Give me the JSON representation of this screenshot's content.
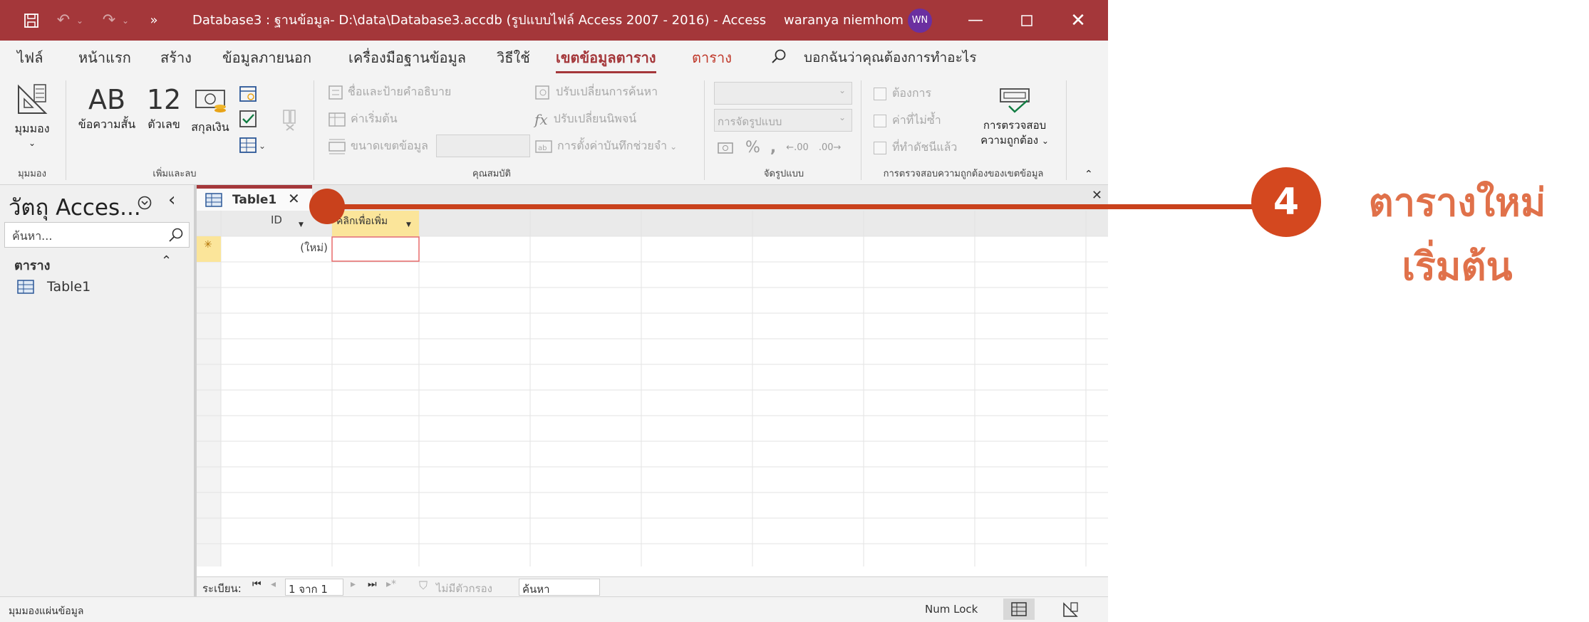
{
  "titlebar": {
    "title": "Database3 : ฐานข้อมูล- D:\\data\\Database3.accdb (รูปแบบไฟล์ Access 2007 - 2016)  -  Access",
    "user": "waranya niemhom",
    "user_initials": "WN",
    "accent": "#a4373a"
  },
  "tabs": [
    {
      "label": "ไฟล์"
    },
    {
      "label": "หน้าแรก"
    },
    {
      "label": "สร้าง"
    },
    {
      "label": "ข้อมูลภายนอก"
    },
    {
      "label": "เครื่องมือฐานข้อมูล"
    },
    {
      "label": "วิธีใช้"
    },
    {
      "label": "เขตข้อมูลตาราง"
    },
    {
      "label": "ตาราง"
    }
  ],
  "tell_me": "บอกฉันว่าคุณต้องการทำอะไร",
  "ribbon": {
    "views": {
      "label": "มุมมอง",
      "group": "มุมมอง"
    },
    "add_delete": {
      "group": "เพิ่มและลบ",
      "short_text_glyph": "AB",
      "short_text": "ข้อความสั้น",
      "number_glyph": "12",
      "number": "ตัวเลข",
      "currency": "สกุลเงิน"
    },
    "properties": {
      "group": "คุณสมบัติ",
      "name_caption": "ชื่อและป้ายคำอธิบาย",
      "default_value": "ค่าเริ่มต้น",
      "field_size": "ขนาดเขตข้อมูล",
      "modify_lookups": "ปรับเปลี่ยนการค้นหา",
      "modify_expression": "ปรับเปลี่ยนนิพจน์",
      "memo_settings": "การตั้งค่าบันทึกช่วยจำ"
    },
    "formatting": {
      "group": "จัดรูปแบบ",
      "format": "การจัดรูปแบบ"
    },
    "validation": {
      "group": "การตรวจสอบความถูกต้องของเขตข้อมูล",
      "required": "ต้องการ",
      "unique": "ค่าที่ไม่ซ้ำ",
      "indexed": "ที่ทำดัชนีแล้ว",
      "validation_line1": "การตรวจสอบ",
      "validation_line2": "ความถูกต้อง"
    }
  },
  "nav": {
    "title": "วัตถุ Acces...",
    "search_placeholder": "ค้นหา...",
    "section": "ตาราง",
    "items": [
      {
        "label": "Table1"
      }
    ]
  },
  "document": {
    "tab_label": "Table1",
    "columns": [
      {
        "label": "ID"
      },
      {
        "label": "คลิกเพื่อเพิ่ม"
      }
    ],
    "new_row_marker": "(ใหม่)",
    "new_row_selector": "✳"
  },
  "record_nav": {
    "label": "ระเบียน:",
    "position": "1 จาก 1",
    "filter": "ไม่มีตัวกรอง",
    "search": "ค้นหา"
  },
  "statusbar": {
    "view": "มุมมองแผ่นข้อมูล",
    "num_lock": "Num Lock"
  },
  "callout": {
    "number": "4",
    "line1": "ตารางใหม่",
    "line2": "เริ่มต้น",
    "color": "#c9411c"
  }
}
